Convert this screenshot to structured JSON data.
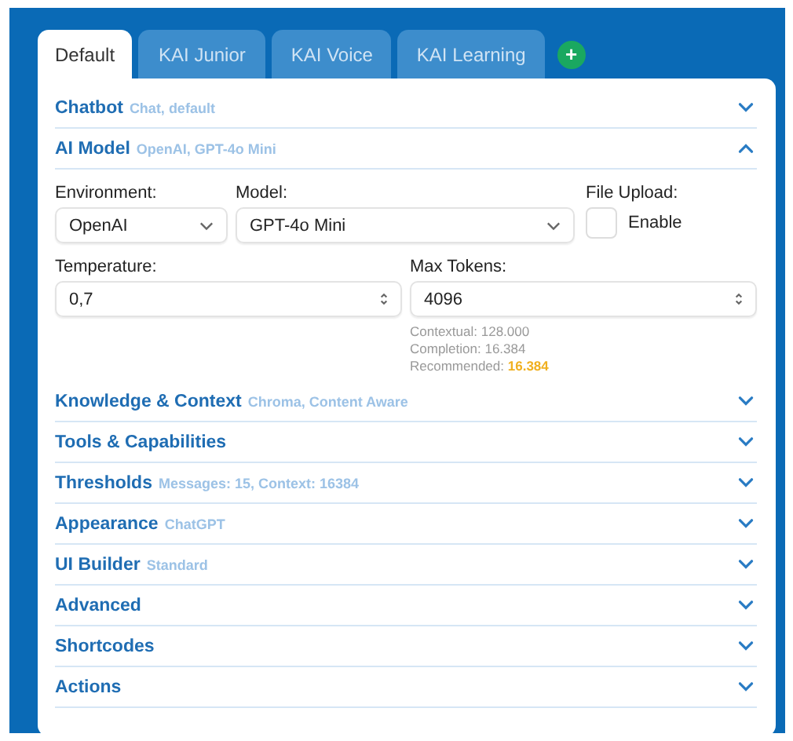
{
  "tabs": [
    {
      "label": "Default",
      "selected": true
    },
    {
      "label": "KAI Junior",
      "selected": false
    },
    {
      "label": "KAI Voice",
      "selected": false
    },
    {
      "label": "KAI Learning",
      "selected": false
    }
  ],
  "add_tab": "+",
  "sections": [
    {
      "title": "Chatbot",
      "summary": "Chat, default",
      "expanded": false
    },
    {
      "title": "AI Model",
      "summary": "OpenAI, GPT-4o Mini",
      "expanded": true,
      "environment": {
        "label": "Environment:",
        "value": "OpenAI"
      },
      "model": {
        "label": "Model:",
        "value": "GPT-4o Mini"
      },
      "file_upload": {
        "label": "File Upload:",
        "option": "Enable",
        "checked": false
      },
      "temperature": {
        "label": "Temperature:",
        "value": "0,7"
      },
      "max_tokens": {
        "label": "Max Tokens:",
        "value": "4096"
      },
      "notes": [
        {
          "text": "Contextual: 128.000"
        },
        {
          "text": "Completion: 16.384"
        },
        {
          "text": "Recommended:",
          "highlight": "16.384"
        }
      ]
    },
    {
      "title": "Knowledge & Context",
      "summary": "Chroma, Content Aware",
      "expanded": false
    },
    {
      "title": "Tools & Capabilities",
      "expanded": false
    },
    {
      "title": "Thresholds",
      "summary": "Messages: 15, Context: 16384",
      "expanded": false
    },
    {
      "title": "Appearance",
      "summary": "ChatGPT",
      "expanded": false
    },
    {
      "title": "UI Builder",
      "summary": "Standard",
      "expanded": false
    },
    {
      "title": "Advanced",
      "expanded": false
    },
    {
      "title": "Shortcodes",
      "expanded": false
    },
    {
      "title": "Actions",
      "expanded": false
    }
  ]
}
